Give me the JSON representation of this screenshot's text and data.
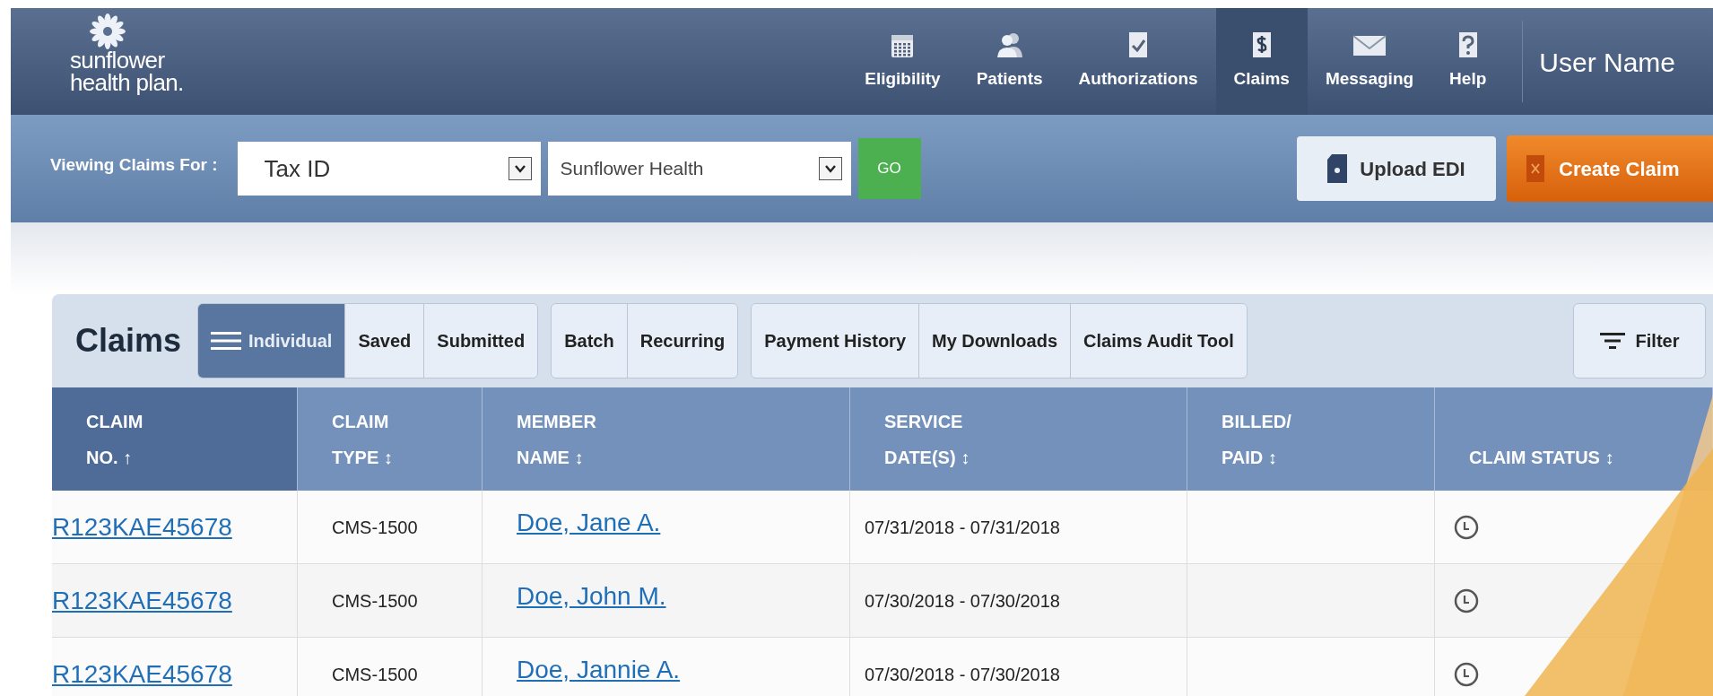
{
  "header": {
    "logo": {
      "line1": "sunflower",
      "line2": "health plan."
    },
    "nav": [
      {
        "label": "Eligibility",
        "selected": false
      },
      {
        "label": "Patients",
        "selected": false
      },
      {
        "label": "Authorizations",
        "selected": false
      },
      {
        "label": "Claims",
        "selected": true
      },
      {
        "label": "Messaging",
        "selected": false
      },
      {
        "label": "Help",
        "selected": false
      }
    ],
    "user": "User Name"
  },
  "filter_bar": {
    "label": "Viewing Claims For :",
    "selects": [
      {
        "value": "Tax ID"
      },
      {
        "value": "Sunflower Health"
      }
    ],
    "go": "GO",
    "upload": "Upload EDI",
    "create": "Create Claim"
  },
  "claims_toolbar": {
    "title": "Claims",
    "groups": [
      [
        {
          "label": "Individual",
          "selected": true
        },
        {
          "label": "Saved",
          "selected": false
        },
        {
          "label": "Submitted",
          "selected": false
        }
      ],
      [
        {
          "label": "Batch",
          "selected": false
        },
        {
          "label": "Recurring",
          "selected": false
        }
      ],
      [
        {
          "label": "Payment History",
          "selected": false
        },
        {
          "label": "My Downloads",
          "selected": false
        },
        {
          "label": "Claims Audit Tool",
          "selected": false
        }
      ]
    ],
    "filter": "Filter"
  },
  "table": {
    "columns": [
      {
        "line1": "CLAIM",
        "line2": "NO. ↑",
        "selected": true
      },
      {
        "line1": "CLAIM",
        "line2": "TYPE ↕",
        "selected": false
      },
      {
        "line1": "MEMBER",
        "line2": "NAME ↕",
        "selected": false
      },
      {
        "line1": "SERVICE",
        "line2": "DATE(S) ↕",
        "selected": false
      },
      {
        "line1": "BILLED/",
        "line2": "PAID ↕",
        "selected": false
      },
      {
        "line2": "CLAIM STATUS ↕",
        "selected": false
      }
    ],
    "rows": [
      {
        "claim_no": "R123KAE45678",
        "type": "CMS-1500",
        "member": "Doe, Jane A.",
        "dates": "07/31/2018 - 07/31/2018"
      },
      {
        "claim_no": "R123KAE45678",
        "type": "CMS-1500",
        "member": "Doe, John M.",
        "dates": "07/30/2018 - 07/30/2018"
      },
      {
        "claim_no": "R123KAE45678",
        "type": "CMS-1500",
        "member": "Doe, Jannie A.",
        "dates": "07/30/2018 - 07/30/2018"
      }
    ]
  }
}
